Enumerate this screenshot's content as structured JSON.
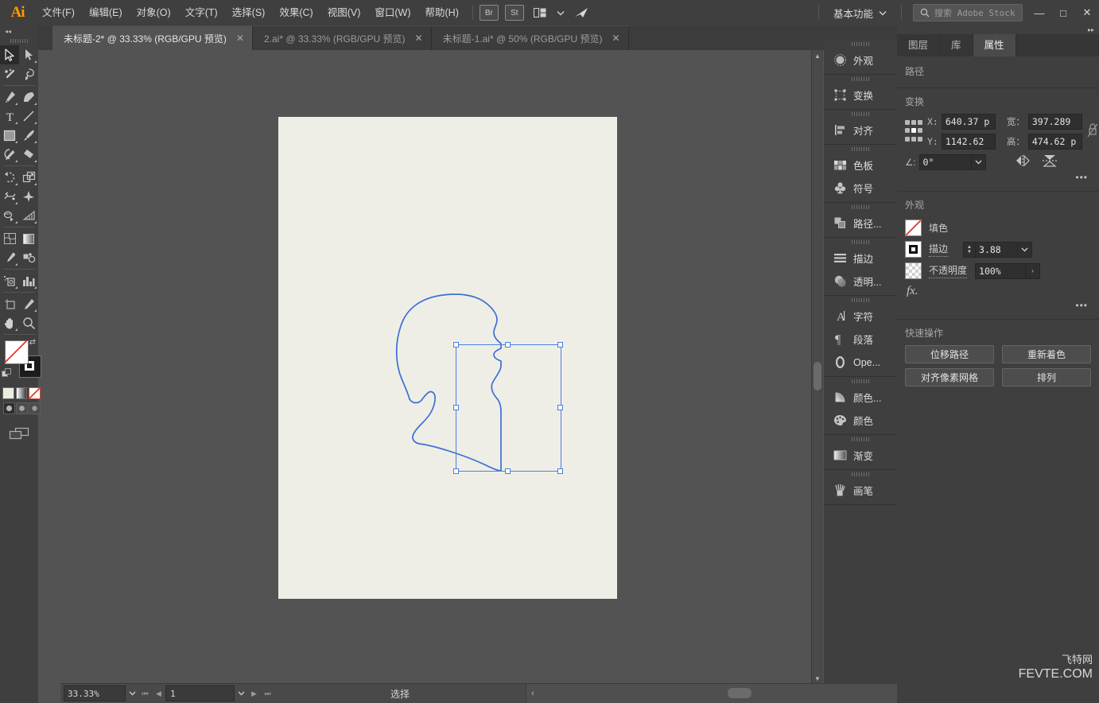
{
  "app": {
    "name": "Ai",
    "menus": [
      "文件(F)",
      "编辑(E)",
      "对象(O)",
      "文字(T)",
      "选择(S)",
      "效果(C)",
      "视图(V)",
      "窗口(W)",
      "帮助(H)"
    ],
    "quick_buttons": [
      "Br",
      "St"
    ],
    "workspace": "基本功能",
    "search_placeholder": "搜索 Adobe Stock",
    "window_buttons": [
      "—",
      "□",
      "✕"
    ]
  },
  "tabs": [
    {
      "label": "未标题-2* @ 33.33% (RGB/GPU 预览)",
      "active": true,
      "close": "✕"
    },
    {
      "label": "2.ai* @ 33.33% (RGB/GPU 预览)",
      "active": false,
      "close": "✕"
    },
    {
      "label": "未标题-1.ai* @ 50% (RGB/GPU 预览)",
      "active": false,
      "close": "✕"
    }
  ],
  "toolbar": {
    "collapse": "◂◂",
    "tools": [
      {
        "name": "selection-tool",
        "glyph": "selection",
        "selected": true,
        "flyout": false
      },
      {
        "name": "direct-selection-tool",
        "glyph": "direct-selection",
        "selected": false,
        "flyout": true
      },
      {
        "name": "magic-wand-tool",
        "glyph": "magic-wand",
        "selected": false,
        "flyout": false
      },
      {
        "name": "lasso-tool",
        "glyph": "lasso",
        "selected": false,
        "flyout": false
      },
      {
        "name": "pen-tool",
        "glyph": "pen",
        "selected": false,
        "flyout": true
      },
      {
        "name": "curvature-tool",
        "glyph": "curvature",
        "selected": false,
        "flyout": false
      },
      {
        "name": "type-tool",
        "glyph": "type",
        "selected": false,
        "flyout": true
      },
      {
        "name": "line-segment-tool",
        "glyph": "line",
        "selected": false,
        "flyout": true
      },
      {
        "name": "rectangle-tool",
        "glyph": "rectangle",
        "selected": false,
        "flyout": true
      },
      {
        "name": "paintbrush-tool",
        "glyph": "brush",
        "selected": false,
        "flyout": true
      },
      {
        "name": "shaper-tool",
        "glyph": "shaper",
        "selected": false,
        "flyout": true
      },
      {
        "name": "eraser-tool",
        "glyph": "eraser",
        "selected": false,
        "flyout": true
      },
      {
        "name": "rotate-tool",
        "glyph": "rotate",
        "selected": false,
        "flyout": true
      },
      {
        "name": "scale-tool",
        "glyph": "scale",
        "selected": false,
        "flyout": true
      },
      {
        "name": "width-tool",
        "glyph": "width",
        "selected": false,
        "flyout": true
      },
      {
        "name": "free-transform-tool",
        "glyph": "free-transform",
        "selected": false,
        "flyout": false
      },
      {
        "name": "shape-builder-tool",
        "glyph": "shape-builder",
        "selected": false,
        "flyout": true
      },
      {
        "name": "perspective-grid-tool",
        "glyph": "perspective",
        "selected": false,
        "flyout": true
      },
      {
        "name": "mesh-tool",
        "glyph": "mesh",
        "selected": false,
        "flyout": false
      },
      {
        "name": "gradient-tool",
        "glyph": "gradient",
        "selected": false,
        "flyout": false
      },
      {
        "name": "eyedropper-tool",
        "glyph": "eyedropper",
        "selected": false,
        "flyout": true
      },
      {
        "name": "blend-tool",
        "glyph": "blend",
        "selected": false,
        "flyout": false
      },
      {
        "name": "symbol-sprayer-tool",
        "glyph": "symbol-sprayer",
        "selected": false,
        "flyout": true
      },
      {
        "name": "column-graph-tool",
        "glyph": "graph",
        "selected": false,
        "flyout": true
      },
      {
        "name": "artboard-tool",
        "glyph": "artboard",
        "selected": false,
        "flyout": false
      },
      {
        "name": "slice-tool",
        "glyph": "slice",
        "selected": false,
        "flyout": true
      },
      {
        "name": "hand-tool",
        "glyph": "hand",
        "selected": false,
        "flyout": true
      },
      {
        "name": "zoom-tool",
        "glyph": "zoom",
        "selected": false,
        "flyout": false
      }
    ]
  },
  "canvas": {
    "artboard_color": "#EEEEE7",
    "background_color": "#535353",
    "selection_color": "#4a7fe0",
    "artwork_name": "head-profile-path"
  },
  "panel_dock": {
    "groups": [
      {
        "items": [
          {
            "label": "外观",
            "icon": "appearance-icon"
          }
        ]
      },
      {
        "items": [
          {
            "label": "变换",
            "icon": "transform-icon"
          }
        ]
      },
      {
        "items": [
          {
            "label": "对齐",
            "icon": "align-icon"
          }
        ]
      },
      {
        "items": [
          {
            "label": "色板",
            "icon": "swatches-icon"
          },
          {
            "label": "符号",
            "icon": "symbols-icon"
          }
        ]
      },
      {
        "items": [
          {
            "label": "路径...",
            "icon": "pathfinder-icon"
          }
        ]
      },
      {
        "items": [
          {
            "label": "描边",
            "icon": "stroke-icon"
          },
          {
            "label": "透明...",
            "icon": "transparency-icon"
          }
        ]
      },
      {
        "items": [
          {
            "label": "字符",
            "icon": "character-icon"
          },
          {
            "label": "段落",
            "icon": "paragraph-icon"
          },
          {
            "label": "Ope...",
            "icon": "opentype-icon"
          }
        ]
      },
      {
        "items": [
          {
            "label": "颜色...",
            "icon": "color-guide-icon"
          },
          {
            "label": "颜色",
            "icon": "color-icon"
          }
        ]
      },
      {
        "items": [
          {
            "label": "渐变",
            "icon": "gradient-icon"
          }
        ]
      },
      {
        "items": [
          {
            "label": "画笔",
            "icon": "brushes-icon"
          }
        ]
      }
    ]
  },
  "properties": {
    "collapse": "▸▸",
    "tabs": [
      {
        "label": "图层",
        "active": false
      },
      {
        "label": "库",
        "active": false
      },
      {
        "label": "属性",
        "active": true
      }
    ],
    "object_type": "路径",
    "transform": {
      "title": "变换",
      "x_label": "X:",
      "x_value": "640.37 p",
      "y_label": "Y:",
      "y_value": "1142.62",
      "w_label": "宽：",
      "w_value": "397.289",
      "h_label": "高：",
      "h_value": "474.62 p",
      "angle_label": "∠:",
      "angle_value": "0°",
      "more": "•••"
    },
    "appearance": {
      "title": "外观",
      "fill_label": "填色",
      "stroke_label": "描边",
      "stroke_weight": "3.88",
      "opacity_label": "不透明度",
      "opacity_value": "100%",
      "fx_label": "fx.",
      "more": "•••"
    },
    "quick_actions": {
      "title": "快速操作",
      "buttons": [
        "位移路径",
        "重新着色",
        "对齐像素网格",
        "排列"
      ]
    }
  },
  "status_bar": {
    "zoom": "33.33%",
    "page": "1",
    "tool_status": "选择"
  },
  "watermark": {
    "line1": "飞特网",
    "line2": "FEVTE.COM"
  }
}
